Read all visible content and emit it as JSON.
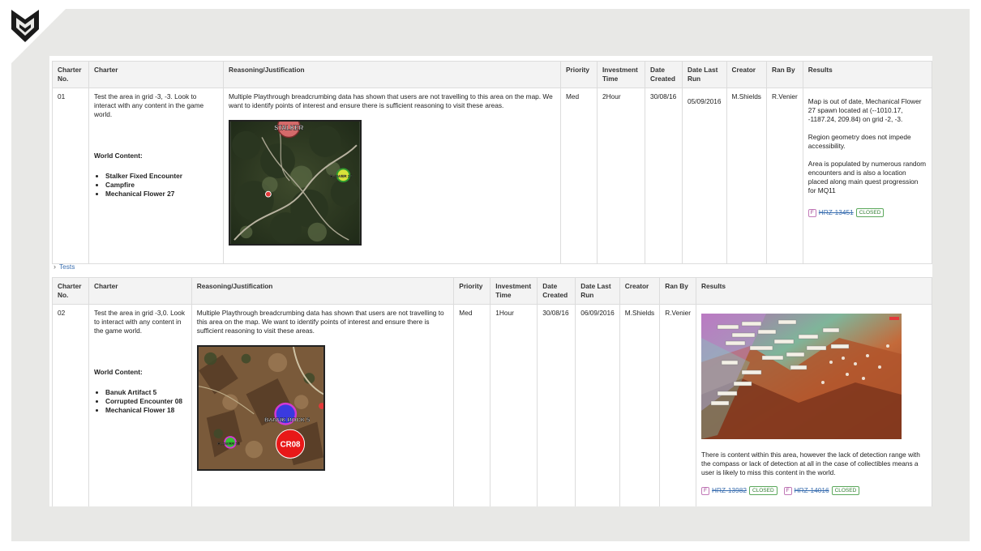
{
  "headers": {
    "charter_no": "Charter No.",
    "charter": "Charter",
    "reasoning": "Reasoning/Justification",
    "priority": "Priority",
    "investment_time": "Investment Time",
    "date_created": "Date Created",
    "date_last_run": "Date Last Run",
    "creator": "Creator",
    "ran_by": "Ran By",
    "results": "Results"
  },
  "world_content_label": "World Content:",
  "tests_link": "Tests",
  "rows": [
    {
      "charter_no": "01",
      "charter": "Test the area in grid -3, -3. Look to interact with any content in the game world.",
      "world_content": [
        "Stalker Fixed Encounter",
        "Campfire",
        "Mechanical Flower 27"
      ],
      "reasoning": "Multiple Playthrough breadcrumbing data has shown that users are not travelling to this area on the map. We want to identify points of interest and ensure there is sufficient reasoning to visit these areas.",
      "map_labels": {
        "top": "STALKER",
        "right": "FLOWER 27"
      },
      "priority": "Med",
      "investment_time": "2Hour",
      "date_created": "30/08/16",
      "date_last_run": "05/09/2016",
      "creator": "M.Shields",
      "ran_by": "R.Venier",
      "results": [
        "Map is out of date, Mechanical Flower 27 spawn located at (--1010.17, -1187.24, 209.84) on grid -2, -3.",
        "Region geometry does not impede accessibility.",
        "Area is populated by numerous random encounters and is also a location placed along main quest progression for MQ11"
      ],
      "tickets": [
        {
          "icon": "F",
          "id": "HRZ-13451",
          "status": "CLOSED"
        }
      ]
    },
    {
      "charter_no": "02",
      "charter": "Test the area in grid -3,0. Look to interact with any content in the game world.",
      "world_content": [
        "Banuk Artifact 5",
        "Corrupted Encounter 08",
        "Mechanical Flower 18"
      ],
      "reasoning": "Multiple Playthrough breadcrumbing data has shown that users are not travelling to this area on the map. We want to identify points of interest and ensure there is sufficient reasoning to visit these areas.",
      "map_labels": {
        "center": "BANUK ROCK 5",
        "badge": "CR08",
        "left": "FLOWER 18"
      },
      "priority": "Med",
      "investment_time": "1Hour",
      "date_created": "30/08/16",
      "date_last_run": "06/09/2016",
      "creator": "M.Shields",
      "ran_by": "R.Venier",
      "results": [
        "There is content within this area, however the lack of detection range with the compass or lack of detection at all in the case of collectibles means a user is likely to miss this content in the world."
      ],
      "tickets": [
        {
          "icon": "F",
          "id": "HRZ-13982",
          "status": "CLOSED"
        },
        {
          "icon": "F",
          "id": "HRZ-14016",
          "status": "CLOSED"
        }
      ]
    }
  ]
}
